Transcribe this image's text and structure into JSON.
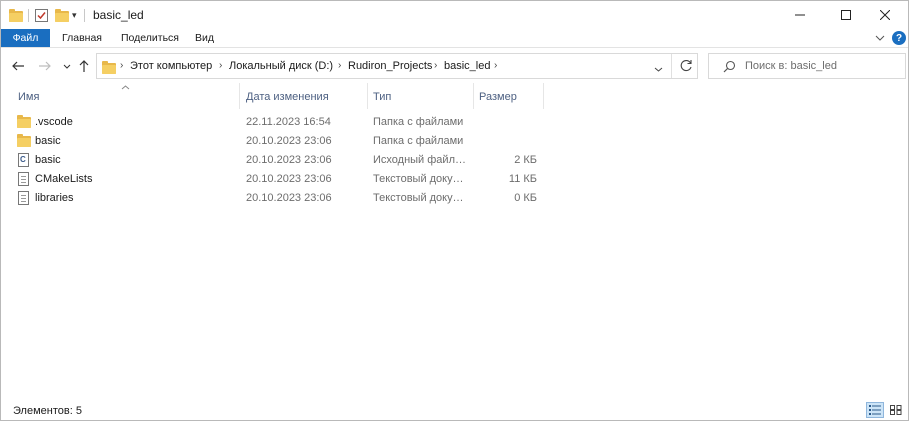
{
  "window": {
    "title": "basic_led",
    "controls": {
      "minimize": "—",
      "maximize": "☐",
      "close": "✕"
    }
  },
  "ribbon": {
    "tabs": [
      "Файл",
      "Главная",
      "Поделиться",
      "Вид"
    ],
    "help_icon": "?",
    "collapse_icon": "chevron-down"
  },
  "navigation": {
    "breadcrumbs": [
      "Этот компьютер",
      "Локальный диск (D:)",
      "Rudiron_Projects",
      "basic_led"
    ],
    "search_placeholder": "Поиск в: basic_led"
  },
  "columns": [
    "Имя",
    "Дата изменения",
    "Тип",
    "Размер"
  ],
  "files": [
    {
      "name": ".vscode",
      "date": "22.11.2023 16:54",
      "type": "Папка с файлами",
      "size": "",
      "icon": "folder"
    },
    {
      "name": "basic",
      "date": "20.10.2023 23:06",
      "type": "Папка с файлами",
      "size": "",
      "icon": "folder"
    },
    {
      "name": "basic",
      "date": "20.10.2023 23:06",
      "type": "Исходный файл C...",
      "size": "2 КБ",
      "icon": "c-source"
    },
    {
      "name": "CMakeLists",
      "date": "20.10.2023 23:06",
      "type": "Текстовый докум...",
      "size": "11 КБ",
      "icon": "text-doc"
    },
    {
      "name": "libraries",
      "date": "20.10.2023 23:06",
      "type": "Текстовый докум...",
      "size": "0 КБ",
      "icon": "text-doc"
    }
  ],
  "status": {
    "item_count": "Элементов: 5"
  },
  "colors": {
    "accent": "#1a6ec0",
    "folder": "#f5cf63",
    "header_text": "#4d6082"
  }
}
